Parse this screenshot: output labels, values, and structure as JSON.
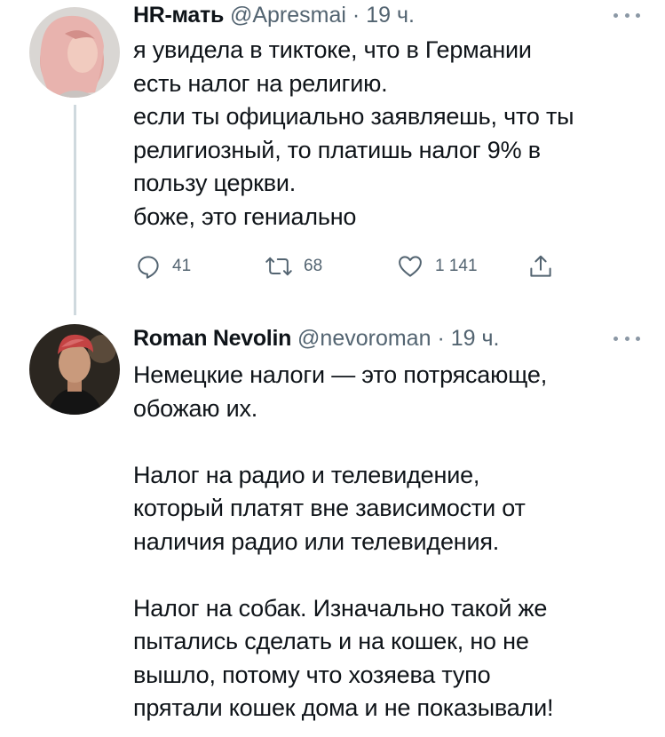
{
  "tweets": [
    {
      "name": "HR-мать",
      "handle": "@Apresmai",
      "separator": "·",
      "time": "19 ч.",
      "text": "я увидела в тиктоке, что в Германии\nесть налог на религию.\nесли ты официально заявляешь, что ты\nрелигиозный, то платишь налог 9% в\nпользу церкви.\nбоже, это гениально",
      "actions": {
        "reply_count": "41",
        "retweet_count": "68",
        "like_count": "1 141"
      }
    },
    {
      "name": "Roman Nevolin",
      "handle": "@nevoroman",
      "separator": "·",
      "time": "19 ч.",
      "text": "Немецкие налоги — это потрясающе,\nобожаю их.\n\nНалог на радио и телевидение,\nкоторый платят вне зависимости от\nналичия радио или телевидения.\n\nНалог на собак. Изначально такой же\nпытались сделать и на кошек, но не\nвышло, потому что хозяева тупо\nпрятали кошек дома и не показывали!"
    }
  ],
  "icons": {
    "reply": "reply-icon",
    "retweet": "retweet-icon",
    "like": "heart-icon",
    "share": "share-icon",
    "more": "more-icon"
  },
  "colors": {
    "text": "#0f1419",
    "secondary": "#536471",
    "thread_line": "#cfd9de"
  }
}
